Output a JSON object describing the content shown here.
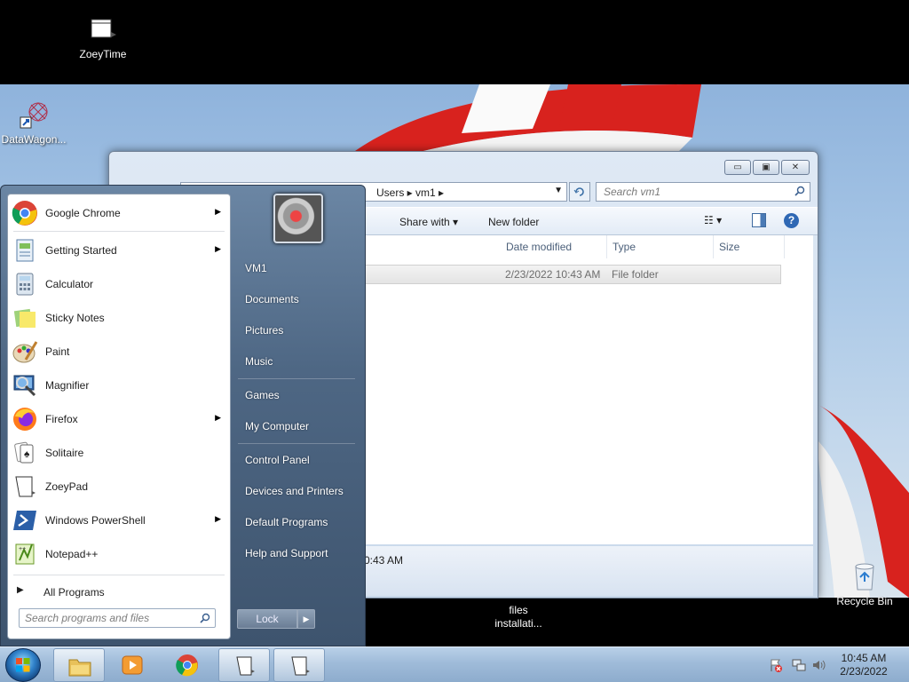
{
  "desktop": {
    "icons": [
      {
        "label": "ZoeyTime",
        "icon": "film-icon"
      },
      {
        "label": "DataWagon...",
        "icon": "shortcut-icon"
      },
      {
        "label": "files installati...",
        "icon": "installer-icon"
      },
      {
        "label": "Recycle Bin",
        "icon": "recycle-bin-icon"
      }
    ]
  },
  "explorer": {
    "breadcrumb": "Users  ▸  vm1  ▸",
    "search_placeholder": "Search vm1",
    "commands": {
      "share_with": "Share with ▾",
      "new_folder": "New folder"
    },
    "columns": [
      "Date modified",
      "Type",
      "Size"
    ],
    "row": {
      "date": "2/23/2022 10:43 AM",
      "type": "File folder"
    },
    "details_text": "0:43 AM",
    "caption_buttons": {
      "minimize": "▭",
      "maximize": "▣",
      "close": "✕"
    }
  },
  "start_menu": {
    "programs": [
      {
        "label": "Google Chrome",
        "submenu": true
      },
      {
        "label": "Getting Started",
        "submenu": true
      },
      {
        "label": "Calculator",
        "submenu": false
      },
      {
        "label": "Sticky Notes",
        "submenu": false
      },
      {
        "label": "Paint",
        "submenu": false
      },
      {
        "label": "Magnifier",
        "submenu": false
      },
      {
        "label": "Firefox",
        "submenu": true
      },
      {
        "label": "Solitaire",
        "submenu": false
      },
      {
        "label": "ZoeyPad",
        "submenu": false
      },
      {
        "label": "Windows PowerShell",
        "submenu": true
      },
      {
        "label": "Notepad++",
        "submenu": false
      }
    ],
    "all_programs": "All Programs",
    "search_placeholder": "Search programs and files",
    "right_links": [
      "VM1",
      "Documents",
      "Pictures",
      "Music",
      "Games",
      "My Computer",
      "Control Panel",
      "Devices and Printers",
      "Default Programs",
      "Help and Support"
    ],
    "lock_label": "Lock"
  },
  "taskbar": {
    "time": "10:45 AM",
    "date": "2/23/2022"
  },
  "colors": {
    "flag_red": "#d8221e",
    "window_glass": "#c8d8ea",
    "taskbar": "#9fbbd9"
  }
}
